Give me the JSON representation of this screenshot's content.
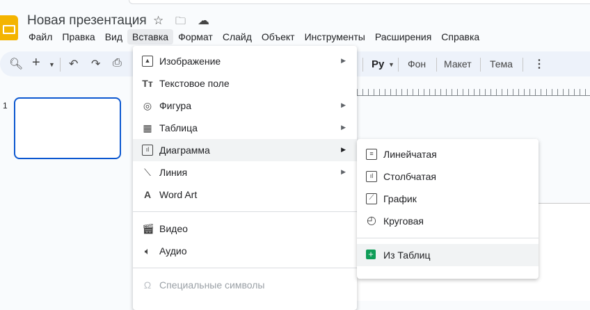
{
  "app": {
    "title": "Новая презентация"
  },
  "menubar": [
    "Файл",
    "Правка",
    "Вид",
    "Вставка",
    "Формат",
    "Слайд",
    "Объект",
    "Инструменты",
    "Расширения",
    "Справка"
  ],
  "toolbar": {
    "input_tools": "Pу",
    "background": "Фон",
    "layout": "Макет",
    "theme": "Тема"
  },
  "slides": {
    "number": "1"
  },
  "insert_menu": {
    "items": [
      "Изображение",
      "Текстовое поле",
      "Фигура",
      "Таблица",
      "Диаграмма",
      "Линия",
      "Word Art",
      "Видео",
      "Аудио",
      "Специальные символы"
    ]
  },
  "chart_submenu": {
    "items": [
      "Линейчатая",
      "Столбчатая",
      "График",
      "Круговая",
      "Из Таблиц"
    ]
  },
  "colors": {
    "accent": "#0b57d0",
    "sheets": "#0f9d58",
    "logo": "#f4b400"
  }
}
